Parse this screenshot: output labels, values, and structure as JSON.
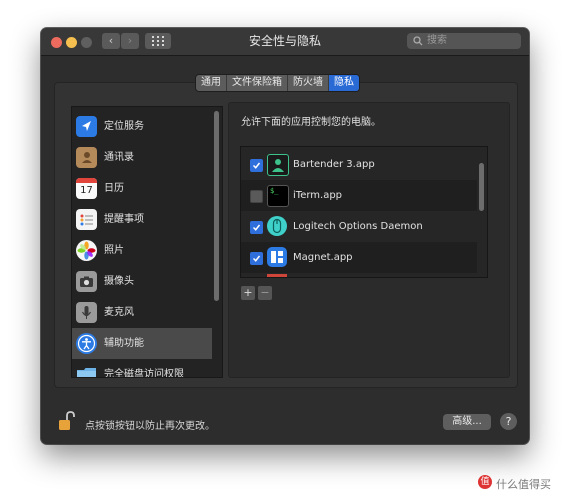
{
  "window": {
    "title": "安全性与隐私",
    "search_placeholder": "搜索"
  },
  "tabs": [
    {
      "label": "通用",
      "active": false
    },
    {
      "label": "文件保险箱",
      "active": false
    },
    {
      "label": "防火墙",
      "active": false
    },
    {
      "label": "隐私",
      "active": true
    }
  ],
  "sidebar": {
    "items": [
      {
        "label": "定位服务",
        "icon": "location-arrow-icon"
      },
      {
        "label": "通讯录",
        "icon": "contacts-book-icon"
      },
      {
        "label": "日历",
        "icon": "calendar-icon",
        "calendar_day": "17"
      },
      {
        "label": "提醒事项",
        "icon": "reminders-icon"
      },
      {
        "label": "照片",
        "icon": "photos-icon"
      },
      {
        "label": "摄像头",
        "icon": "camera-icon"
      },
      {
        "label": "麦克风",
        "icon": "microphone-icon"
      },
      {
        "label": "辅助功能",
        "icon": "accessibility-icon",
        "selected": true
      },
      {
        "label": "完全磁盘访问权限",
        "icon": "folder-icon"
      }
    ]
  },
  "main": {
    "allow_text": "允许下面的应用控制您的电脑。",
    "apps": [
      {
        "name": "Bartender 3.app",
        "checked": true,
        "icon": "bartender-icon"
      },
      {
        "name": "iTerm.app",
        "checked": false,
        "icon": "terminal-icon",
        "icon_text": "$_"
      },
      {
        "name": "Logitech Options Daemon",
        "checked": true,
        "icon": "logitech-mouse-icon"
      },
      {
        "name": "Magnet.app",
        "checked": true,
        "icon": "magnet-grid-icon"
      }
    ],
    "add_label": "+",
    "remove_label": "−"
  },
  "footer": {
    "lock_text": "点按锁按钮以防止再次更改。",
    "advanced_label": "高级...",
    "help_label": "?"
  },
  "watermark": {
    "text": "什么值得买",
    "badge": "值"
  },
  "colors": {
    "accent": "#2a6ad5",
    "window_bg": "#2d2d2d",
    "checkbox_on": "#2f6fdc"
  }
}
